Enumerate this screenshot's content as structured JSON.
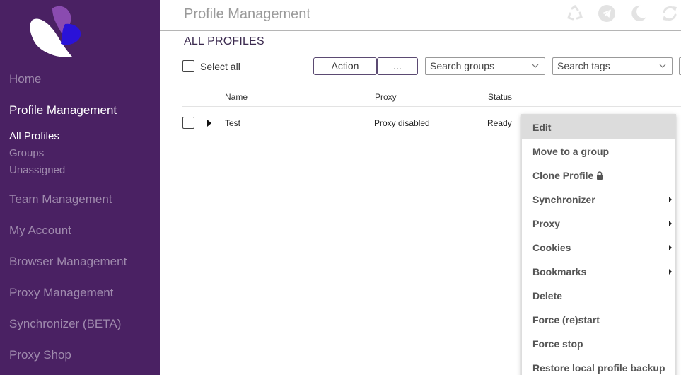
{
  "sidebar": {
    "nav": [
      {
        "label": "Home",
        "active": false
      },
      {
        "label": "Profile Management",
        "active": true
      },
      {
        "label": "Team Management",
        "active": false
      },
      {
        "label": "My Account",
        "active": false
      },
      {
        "label": "Browser Management",
        "active": false
      },
      {
        "label": "Proxy Management",
        "active": false
      },
      {
        "label": "Synchronizer (BETA)",
        "active": false
      },
      {
        "label": "Proxy Shop",
        "active": false
      }
    ],
    "sub": [
      {
        "label": "All Profiles",
        "active": true
      },
      {
        "label": "Groups",
        "active": false
      },
      {
        "label": "Unassigned",
        "active": false
      }
    ]
  },
  "header": {
    "title": "Profile Management",
    "icons": [
      "recycle-icon",
      "telegram-icon",
      "moon-icon",
      "refresh-icon"
    ]
  },
  "section_title": "ALL PROFILES",
  "toolbar": {
    "select_all_label": "Select all",
    "action_label": "Action",
    "more_label": "...",
    "search_groups_placeholder": "Search groups",
    "search_tags_placeholder": "Search tags"
  },
  "table": {
    "columns": [
      "Name",
      "Proxy",
      "Status"
    ],
    "rows": [
      {
        "name": "Test",
        "proxy": "Proxy disabled",
        "status": "Ready"
      }
    ]
  },
  "context_menu": {
    "items": [
      {
        "label": "Edit",
        "highlighted": true,
        "submenu": false
      },
      {
        "label": "Move to a group",
        "submenu": false
      },
      {
        "label": "Clone Profile",
        "submenu": false,
        "icon": "lock-icon"
      },
      {
        "label": "Synchronizer",
        "submenu": true
      },
      {
        "label": "Proxy",
        "submenu": true
      },
      {
        "label": "Cookies",
        "submenu": true
      },
      {
        "label": "Bookmarks",
        "submenu": true
      },
      {
        "label": "Delete",
        "submenu": false
      },
      {
        "label": "Force (re)start",
        "submenu": false
      },
      {
        "label": "Force stop",
        "submenu": false
      },
      {
        "label": "Restore local profile backup",
        "submenu": false
      }
    ]
  },
  "colors": {
    "sidebar_bg": "#4a2163",
    "sidebar_text": "#9f8aad",
    "sidebar_active": "#ffffff",
    "logo_purple": "#8a4bb0",
    "logo_blue": "#2a12d8"
  }
}
